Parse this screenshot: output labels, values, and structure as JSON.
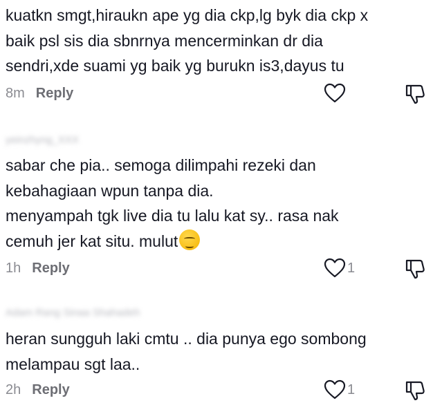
{
  "comments": [
    {
      "username": "",
      "text": "kuatkn smgt,hiraukn ape yg dia ckp,lg byk dia ckp x\nbaik psl sis dia sbnrnya mencerminkan dr dia\nsendri,xde suami yg baik yg burukn is3,dayus tu",
      "time": "8m",
      "reply_label": "Reply",
      "likes": ""
    },
    {
      "username": "yeinzhyng_XXX",
      "text": "sabar che pia.. semoga dilimpahi rezeki dan\nkebahagiaan wpun tanpa dia.\nmenyampah tgk live dia tu lalu kat sy.. rasa nak\ncemuh jer kat situ. mulut",
      "emoji": "smirking-face",
      "time": "1h",
      "reply_label": "Reply",
      "likes": "1"
    },
    {
      "username": "Adam Rang Sinaa Shahadeh",
      "text": "heran sungguh laki cmtu .. dia punya ego sombong\nmelampau sgt laa..",
      "time": "2h",
      "reply_label": "Reply",
      "likes": "1"
    }
  ],
  "icons": {
    "like": "heart-outline-icon",
    "dislike": "thumbs-down-outline-icon"
  },
  "colors": {
    "text": "#161823",
    "meta": "#8a8b91",
    "icon": "#161823"
  }
}
